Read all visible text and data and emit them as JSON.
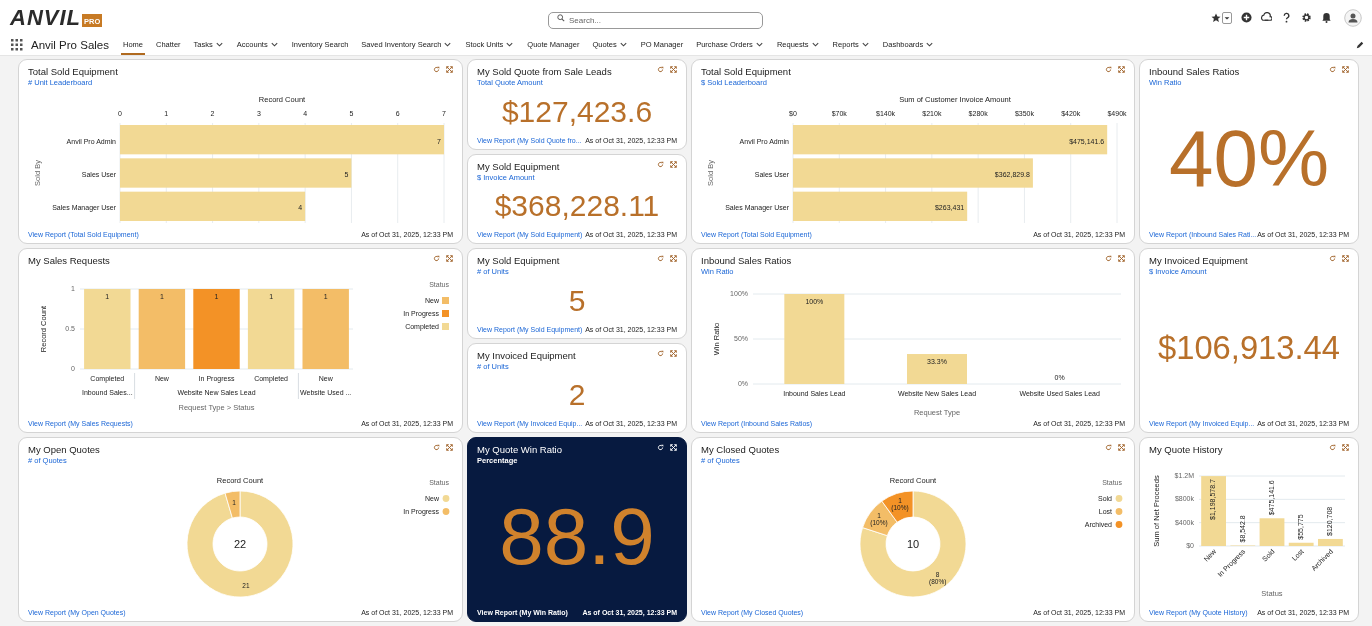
{
  "header": {
    "logo": {
      "text": "ANVIL",
      "badge": "PRO"
    },
    "search": {
      "placeholder": "Search..."
    }
  },
  "nav": {
    "app_name": "Anvil Pro Sales",
    "tabs": [
      {
        "label": "Home",
        "selected": true,
        "dropdown": false
      },
      {
        "label": "Chatter",
        "selected": false,
        "dropdown": false
      },
      {
        "label": "Tasks",
        "selected": false,
        "dropdown": true
      },
      {
        "label": "Accounts",
        "selected": false,
        "dropdown": true
      },
      {
        "label": "Inventory Search",
        "selected": false,
        "dropdown": false
      },
      {
        "label": "Saved Inventory Search",
        "selected": false,
        "dropdown": true
      },
      {
        "label": "Stock Units",
        "selected": false,
        "dropdown": true
      },
      {
        "label": "Quote Manager",
        "selected": false,
        "dropdown": false
      },
      {
        "label": "Quotes",
        "selected": false,
        "dropdown": true
      },
      {
        "label": "PO Manager",
        "selected": false,
        "dropdown": false
      },
      {
        "label": "Purchase Orders",
        "selected": false,
        "dropdown": true
      },
      {
        "label": "Requests",
        "selected": false,
        "dropdown": true
      },
      {
        "label": "Reports",
        "selected": false,
        "dropdown": true
      },
      {
        "label": "Dashboards",
        "selected": false,
        "dropdown": true
      }
    ]
  },
  "rows": [
    {
      "cells": [
        {
          "kind": "chart",
          "title": "Total Sold Equipment",
          "subtitle": "# Unit Leaderboard",
          "link": "View Report (Total Sold Equipment)",
          "timestamp": "As of Oct 31, 2025, 12:33 PM",
          "chart_data": {
            "type": "bar",
            "orientation": "horizontal",
            "grid": true,
            "xlabel": "Record Count",
            "ylabel": "Sold By",
            "categories": [
              "Anvil Pro Admin",
              "Sales User",
              "Sales Manager User"
            ],
            "values": [
              7,
              5,
              4
            ],
            "xlim": [
              0,
              7
            ],
            "xticks": [
              0,
              1,
              2,
              3,
              4,
              5,
              6,
              7
            ],
            "value_labels": [
              "7",
              "5",
              "4"
            ]
          }
        },
        {
          "kind": "stack",
          "cards": [
            {
              "kind": "metric",
              "title": "My Sold Quote from Sale Leads",
              "subtitle": "Total Quote Amount",
              "value": "$127,423.6",
              "link": "View Report (My Sold Quote fro...",
              "timestamp": "As of Oct 31, 2025, 12:33 PM"
            },
            {
              "kind": "metric",
              "title": "My Sold Equipment",
              "subtitle": "$ Invoice Amount",
              "value": "$368,228.11",
              "link": "View Report (My Sold Equipment)",
              "timestamp": "As of Oct 31, 2025, 12:33 PM"
            }
          ]
        },
        {
          "kind": "chart",
          "title": "Total Sold Equipment",
          "subtitle": "$ Sold Leaderboard",
          "link": "View Report (Total Sold Equipment)",
          "timestamp": "As of Oct 31, 2025, 12:33 PM",
          "chart_data": {
            "type": "bar",
            "orientation": "horizontal",
            "grid": true,
            "xlabel": "Sum of Customer Invoice Amount",
            "ylabel": "Sold By",
            "categories": [
              "Anvil Pro Admin",
              "Sales User",
              "Sales Manager User"
            ],
            "values": [
              475141.6,
              362829.8,
              263431
            ],
            "xlim": [
              0,
              490000
            ],
            "xticks": [
              {
                "value": 0,
                "label": "$0"
              },
              {
                "value": 70000,
                "label": "$70k"
              },
              {
                "value": 140000,
                "label": "$140k"
              },
              {
                "value": 210000,
                "label": "$210k"
              },
              {
                "value": 280000,
                "label": "$280k"
              },
              {
                "value": 350000,
                "label": "$350k"
              },
              {
                "value": 420000,
                "label": "$420k"
              },
              {
                "value": 490000,
                "label": "$490k"
              }
            ],
            "value_labels": [
              "$475,141.6",
              "$362,829.8",
              "$263,431"
            ]
          }
        },
        {
          "kind": "metric",
          "title": "Inbound Sales Ratios",
          "subtitle": "Win Ratio",
          "value": "40%",
          "link": "View Report (Inbound Sales Rati...",
          "timestamp": "As of Oct 31, 2025, 12:33 PM"
        }
      ]
    },
    {
      "cells": [
        {
          "kind": "chart",
          "title": "My Sales Requests",
          "legend_title": "Status",
          "link": "View Report (My Sales Requests)",
          "timestamp": "As of Oct 31, 2025, 12:33 PM",
          "chart_data": {
            "type": "bar",
            "orientation": "vertical",
            "grid": true,
            "legend": "right",
            "xlabel": "Request Type > Status",
            "ylabel": "Record Count",
            "categories": [
              "Completed",
              "New",
              "In Progress",
              "Completed",
              "New"
            ],
            "series": [
              {
                "name": "New",
                "color": "#f3bd67",
                "values": [
                  null,
                  1,
                  null,
                  null,
                  1
                ]
              },
              {
                "name": "In Progress",
                "color": "#f39226",
                "values": [
                  null,
                  null,
                  1,
                  null,
                  null
                ]
              },
              {
                "name": "Completed",
                "color": "#f2d994",
                "values": [
                  1,
                  null,
                  null,
                  1,
                  null
                ]
              }
            ],
            "ylim": [
              0,
              1
            ],
            "yticks": [
              0,
              0.5,
              1
            ],
            "data_labels": true,
            "annotations": [
              "Inbound Sales...",
              "Website New Sales Lead",
              "Website Used ..."
            ]
          }
        },
        {
          "kind": "stack",
          "cards": [
            {
              "kind": "metric",
              "title": "My Sold Equipment",
              "subtitle": "# of Units",
              "value": "5",
              "link": "View Report (My Sold Equipment)",
              "timestamp": "As of Oct 31, 2025, 12:33 PM"
            },
            {
              "kind": "metric",
              "title": "My Invoiced Equipment",
              "subtitle": "# of Units",
              "value": "2",
              "link": "View Report (My Invoiced Equip...",
              "timestamp": "As of Oct 31, 2025, 12:33 PM"
            }
          ]
        },
        {
          "kind": "chart",
          "title": "Inbound Sales Ratios",
          "subtitle": "Win Ratio",
          "link": "View Report (Inbound Sales Ratios)",
          "timestamp": "As of Oct 31, 2025, 12:33 PM",
          "chart_data": {
            "type": "bar",
            "orientation": "vertical",
            "grid": true,
            "xlabel": "Request Type",
            "ylabel": "Win Ratio",
            "categories": [
              "Inbound Sales Lead",
              "Website New Sales Lead",
              "Website Used Sales Lead"
            ],
            "values": [
              100,
              33.3,
              0
            ],
            "ylim": [
              0,
              100
            ],
            "yticks": [
              {
                "value": 0,
                "label": "0%"
              },
              {
                "value": 50,
                "label": "50%"
              },
              {
                "value": 100,
                "label": "100%"
              }
            ],
            "value_labels": [
              "100%",
              "33.3%",
              "0%"
            ]
          }
        },
        {
          "kind": "metric",
          "title": "My Invoiced Equipment",
          "subtitle": "$ Invoice Amount",
          "value": "$106,913.44",
          "link": "View Report (My Invoiced Equip...",
          "timestamp": "As of Oct 31, 2025, 12:33 PM"
        }
      ]
    },
    {
      "cells": [
        {
          "kind": "chart",
          "title": "My Open Quotes",
          "subtitle": "# of Quotes",
          "legend_title": "Status",
          "center_label": "22",
          "link": "View Report (My Open Quotes)",
          "timestamp": "As of Oct 31, 2025, 12:33 PM",
          "chart_data": {
            "type": "donut",
            "legend": "right",
            "title": "Record Count",
            "categories": [
              "New",
              "In Progress"
            ],
            "values": [
              21,
              1
            ],
            "colors": [
              "#f2d994",
              "#f3bd67"
            ],
            "value_labels": [
              "21",
              "1"
            ]
          }
        },
        {
          "kind": "metric",
          "dark": true,
          "title": "My Quote Win Ratio",
          "subtitle": "Percentage",
          "value": "88.9",
          "link": "View Report (My Win Ratio)",
          "timestamp": "As of Oct 31, 2025, 12:33 PM"
        },
        {
          "kind": "chart",
          "title": "My Closed Quotes",
          "subtitle": "# of Quotes",
          "legend_title": "Status",
          "center_label": "10",
          "link": "View Report (My Closed Quotes)",
          "timestamp": "As of Oct 31, 2025, 12:33 PM",
          "chart_data": {
            "type": "donut",
            "legend": "right",
            "title": "Record Count",
            "categories": [
              "Sold",
              "Lost",
              "Archived"
            ],
            "values": [
              8,
              1,
              1
            ],
            "colors": [
              "#f2d994",
              "#f3bd67",
              "#f39226"
            ],
            "value_labels": [
              "8 (80%)",
              "1 (10%)",
              "1 (10%)"
            ]
          }
        },
        {
          "kind": "chart",
          "title": "My Quote History",
          "link": "View Report (My Quote History)",
          "timestamp": "As of Oct 31, 2025, 12:33 PM",
          "chart_data": {
            "type": "bar",
            "orientation": "vertical",
            "grid": true,
            "xlabel": "Status",
            "ylabel": "Sum of Net Proceeds",
            "categories": [
              "New",
              "In Progress",
              "Sold",
              "Lost",
              "Archived"
            ],
            "values": [
              1198578.7,
              8542.8,
              475141.6,
              55775,
              120708
            ],
            "ylim": [
              0,
              1200000
            ],
            "yticks": [
              {
                "value": 0,
                "label": "$0"
              },
              {
                "value": 400000,
                "label": "$400k"
              },
              {
                "value": 800000,
                "label": "$800k"
              },
              {
                "value": 1200000,
                "label": "$1.2M"
              }
            ],
            "value_labels": [
              "$1,198,578.7",
              "$8,542.8",
              "$475,141.6",
              "$55,775",
              "$120,708"
            ]
          }
        }
      ]
    }
  ]
}
